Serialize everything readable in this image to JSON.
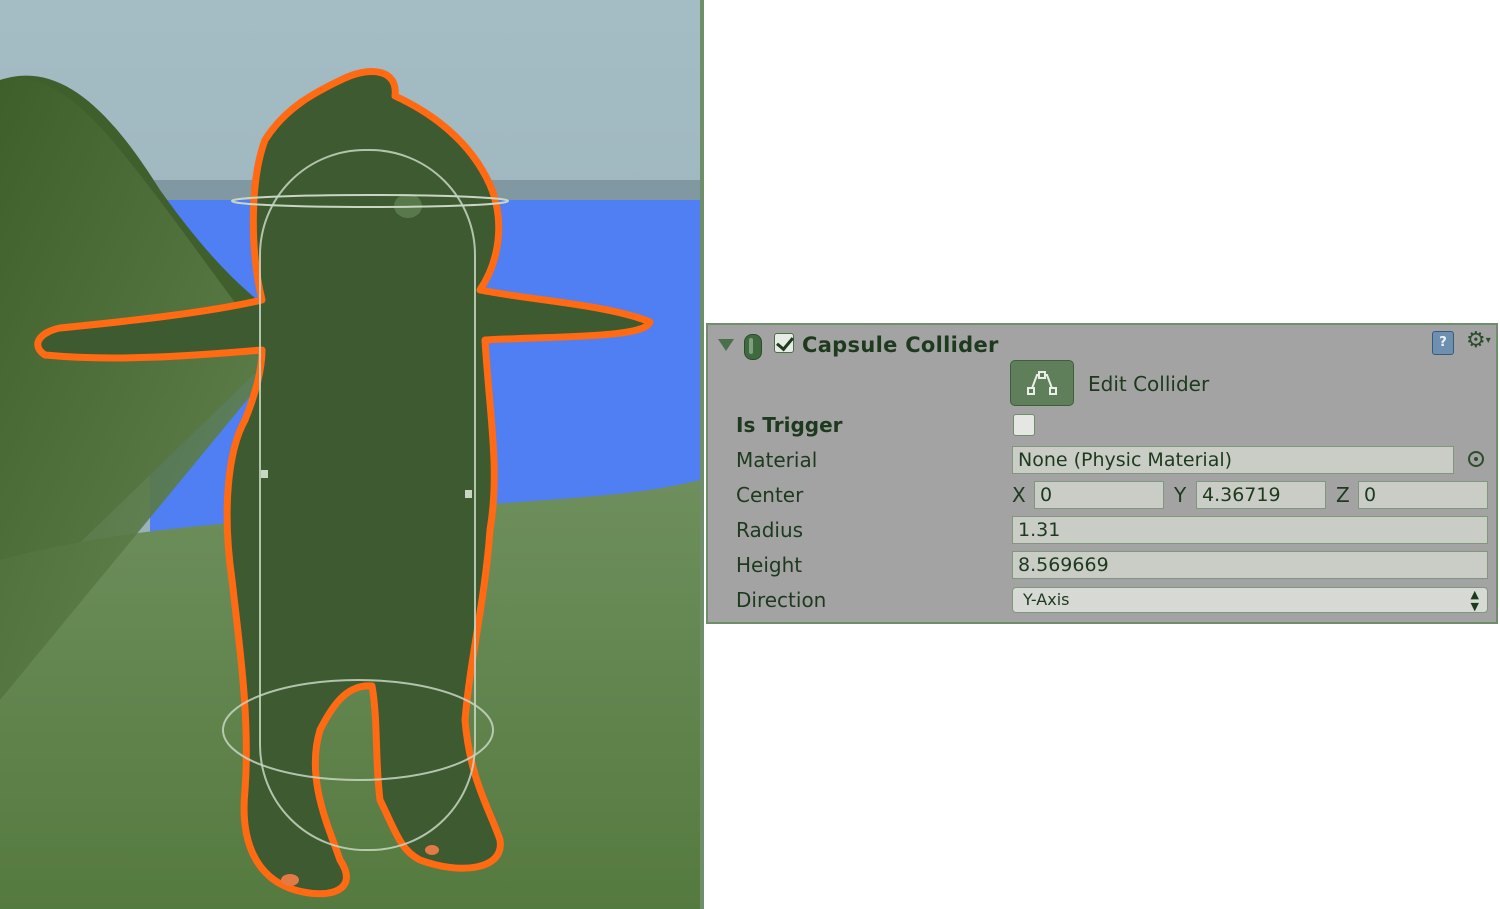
{
  "component": {
    "title": "Capsule Collider",
    "enabled": true,
    "help_icon": "help-book-icon",
    "help_glyph": "?",
    "settings_icon": "gear-icon"
  },
  "edit_collider": {
    "label": "Edit Collider",
    "icon": "edit-shape-icon"
  },
  "properties": {
    "is_trigger": {
      "label": "Is Trigger",
      "checked": false
    },
    "material": {
      "label": "Material",
      "value": "None (Physic Material)",
      "picker_icon": "object-picker-icon"
    },
    "center": {
      "label": "Center",
      "x_label": "X",
      "x": "0",
      "y_label": "Y",
      "y": "4.36719",
      "z_label": "Z",
      "z": "0"
    },
    "radius": {
      "label": "Radius",
      "value": "1.31"
    },
    "height": {
      "label": "Height",
      "value": "8.569669"
    },
    "direction": {
      "label": "Direction",
      "value": "Y-Axis"
    }
  },
  "colors": {
    "inspector_bg": "#a3a3a3",
    "text": "#1e3a1e",
    "selection_outline": "#ff6a13",
    "water": "#4f7ff2",
    "terrain": "#5f7f4a",
    "sky": "#9fb5bc",
    "character": "#3d5a31"
  }
}
